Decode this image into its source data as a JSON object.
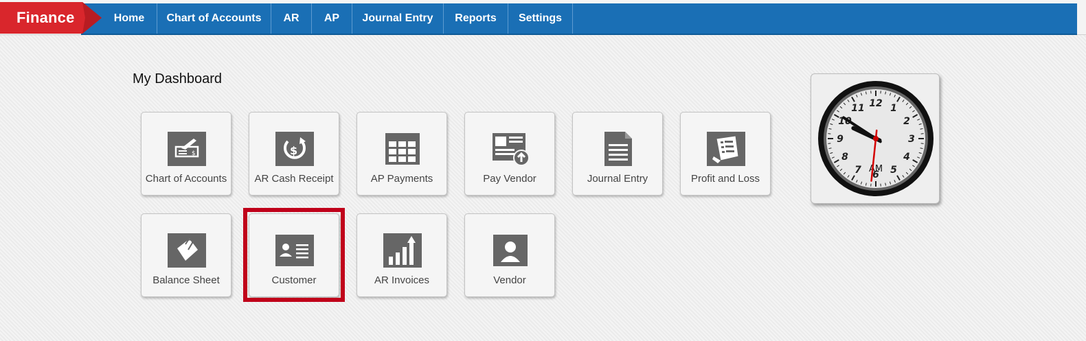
{
  "brand": {
    "label": "Finance",
    "color": "#d9262c"
  },
  "nav": {
    "items": [
      {
        "label": "Home"
      },
      {
        "label": "Chart of Accounts"
      },
      {
        "label": "AR"
      },
      {
        "label": "AP"
      },
      {
        "label": "Journal Entry"
      },
      {
        "label": "Reports"
      },
      {
        "label": "Settings"
      }
    ],
    "color": "#1a6fb5"
  },
  "dashboard": {
    "title": "My Dashboard",
    "tiles": [
      {
        "label": "Chart of Accounts",
        "icon": "check-icon"
      },
      {
        "label": "AR Cash Receipt",
        "icon": "dollar-refresh-icon"
      },
      {
        "label": "AP Payments",
        "icon": "grid-icon"
      },
      {
        "label": "Pay Vendor",
        "icon": "news-upload-icon"
      },
      {
        "label": "Journal Entry",
        "icon": "document-icon"
      },
      {
        "label": "Profit and Loss",
        "icon": "receipt-icon"
      },
      {
        "label": "Balance Sheet",
        "icon": "paperclip-note-icon"
      },
      {
        "label": "Customer",
        "icon": "id-card-icon",
        "highlighted": true
      },
      {
        "label": "AR Invoices",
        "icon": "bar-chart-up-icon"
      },
      {
        "label": "Vendor",
        "icon": "user-icon"
      }
    ],
    "highlight_color": "#c0001a"
  },
  "clock": {
    "numerals": [
      "12",
      "1",
      "2",
      "3",
      "4",
      "5",
      "6",
      "7",
      "8",
      "9",
      "10",
      "11"
    ],
    "period": "AM",
    "time": {
      "hour": 9,
      "minute": 50,
      "second": 31
    },
    "second_hand_color": "#d40000"
  }
}
